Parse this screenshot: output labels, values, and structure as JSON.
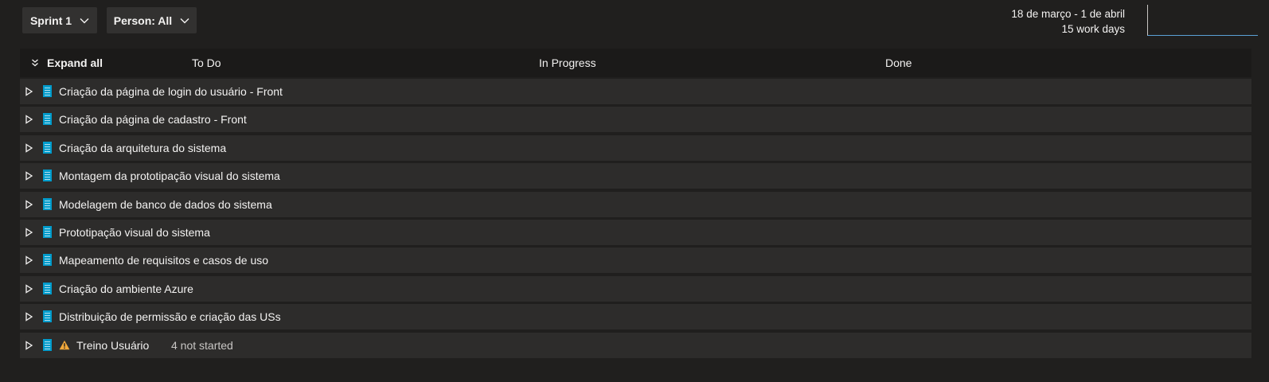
{
  "filters": {
    "sprint_label": "Sprint 1",
    "person_label": "Person: All"
  },
  "sprint": {
    "date_range": "18 de março - 1 de abril",
    "work_days": "15 work days"
  },
  "board": {
    "expand_all_label": "Expand all",
    "columns": [
      "To Do",
      "In Progress",
      "Done"
    ]
  },
  "rows": [
    {
      "title": "Criação da página de login do usuário - Front"
    },
    {
      "title": "Criação da página de cadastro - Front"
    },
    {
      "title": "Criação da arquitetura do sistema"
    },
    {
      "title": "Montagem da prototipação visual do sistema"
    },
    {
      "title": "Modelagem de banco de dados do sistema"
    },
    {
      "title": "Prototipação visual do sistema"
    },
    {
      "title": "Mapeamento de requisitos e casos de uso"
    },
    {
      "title": "Criação do ambiente Azure"
    },
    {
      "title": "Distribuição de permissão e criação das USs"
    },
    {
      "title": "Treino Usuário",
      "note": "4 not started",
      "warning": true
    }
  ],
  "icons": {
    "row_expand": "triangle-right-icon",
    "work_item": "user-story-icon",
    "warning": "warning-icon",
    "dropdown": "chevron-down-icon",
    "expand_all": "double-chevron-down-icon"
  },
  "colors": {
    "background": "#201f1e",
    "row": "#2d2c2b",
    "header": "#1b1a19",
    "user_story": "#009ccc",
    "warning": "#f2a93b",
    "burndown_line": "#5aa0d6"
  }
}
